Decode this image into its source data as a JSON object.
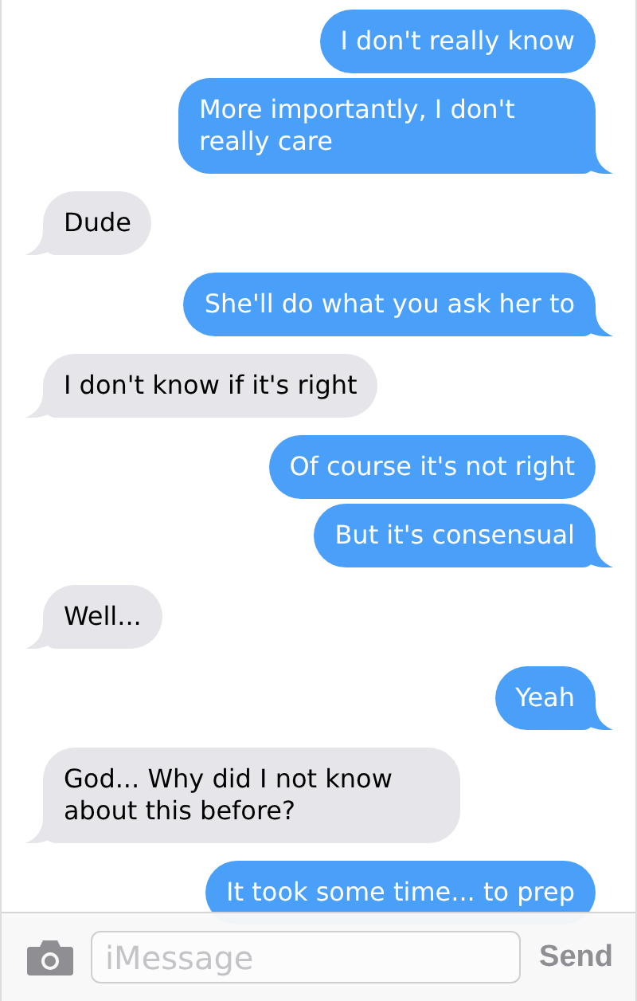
{
  "messages": [
    {
      "kind": "sent",
      "text": "I don't really know",
      "tail": false
    },
    {
      "kind": "sent",
      "text": "More importantly, I don't really care",
      "tail": true
    },
    {
      "kind": "received",
      "text": "Dude",
      "tail": true
    },
    {
      "kind": "sent",
      "text": "She'll do what you ask her to",
      "tail": true
    },
    {
      "kind": "received",
      "text": "I don't know if it's right",
      "tail": true
    },
    {
      "kind": "sent",
      "text": "Of course it's not right",
      "tail": false
    },
    {
      "kind": "sent",
      "text": "But it's consensual",
      "tail": true
    },
    {
      "kind": "received",
      "text": "Well...",
      "tail": true
    },
    {
      "kind": "sent",
      "text": "Yeah",
      "tail": true
    },
    {
      "kind": "received",
      "text": "God... Why did I not know about this before?",
      "tail": true
    },
    {
      "kind": "sent",
      "text": "It took some time... to prep",
      "tail": false
    }
  ],
  "composer": {
    "placeholder": "iMessage",
    "send": "Send"
  }
}
